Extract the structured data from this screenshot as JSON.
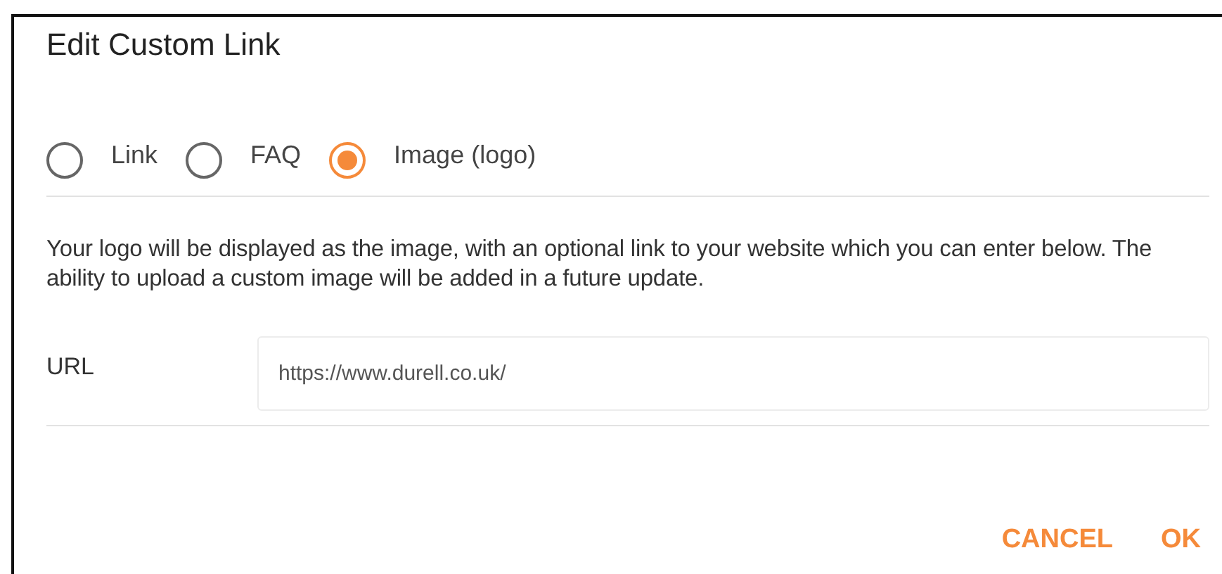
{
  "dialog": {
    "title": "Edit Custom Link"
  },
  "options": [
    {
      "label": "Link",
      "selected": false
    },
    {
      "label": "FAQ",
      "selected": false
    },
    {
      "label": "Image (logo)",
      "selected": true
    }
  ],
  "description": "Your logo will be displayed as the image, with an optional link to your website which you can enter below. The ability to upload a custom image will be added in a future update.",
  "url": {
    "label": "URL",
    "value": "https://www.durell.co.uk/"
  },
  "buttons": [
    "CANCEL",
    "OK"
  ]
}
